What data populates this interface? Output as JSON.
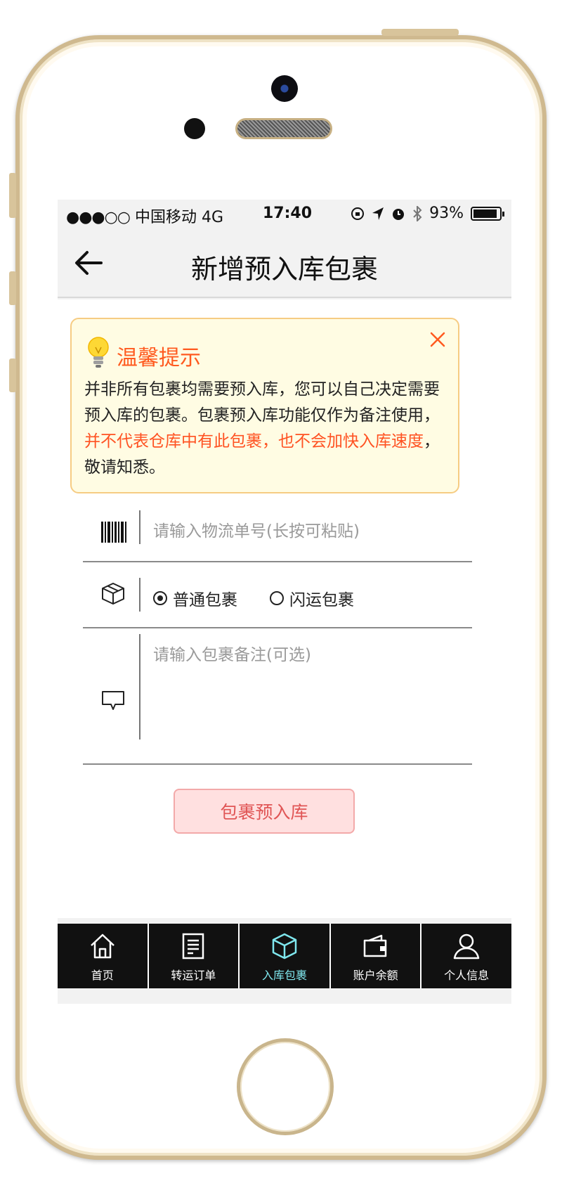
{
  "status": {
    "signal": "●●●○○",
    "carrier": "中国移动",
    "network": "4G",
    "time": "17:40",
    "battery": "93%",
    "battery_level": 0.93
  },
  "nav": {
    "title": "新增预入库包裹"
  },
  "tip": {
    "title": "温馨提示",
    "line1": "并非所有包裹均需要预入库，您可以自己决定需要",
    "line2": "预入库的包裹。包裹预入库功能仅作为备注使用，",
    "line3_red": "并不代表仓库中有此包裹，也不会加快入库速度",
    "line3_tail": "，",
    "line4": "敬请知悉。"
  },
  "form": {
    "tracking_placeholder": "请输入物流单号(长按可粘贴)",
    "type_options": [
      {
        "label": "普通包裹",
        "selected": true
      },
      {
        "label": "闪运包裹",
        "selected": false
      }
    ],
    "note_placeholder": "请输入包裹备注(可选)",
    "submit_label": "包裹预入库"
  },
  "tabs": [
    {
      "label": "首页",
      "icon": "home-icon",
      "active": false
    },
    {
      "label": "转运订单",
      "icon": "document-icon",
      "active": false
    },
    {
      "label": "入库包裹",
      "icon": "box-icon",
      "active": true
    },
    {
      "label": "账户余额",
      "icon": "wallet-icon",
      "active": false
    },
    {
      "label": "个人信息",
      "icon": "user-icon",
      "active": false
    }
  ],
  "colors": {
    "accent_orange": "#ff5a1f",
    "tip_bg": "#fffce3",
    "tab_active": "#7fe7ee",
    "submit_bg": "#ffe0e0"
  }
}
